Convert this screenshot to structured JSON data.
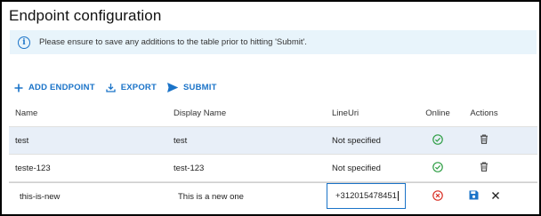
{
  "title": "Endpoint configuration",
  "banner": {
    "icon": "info-icon",
    "message": "Please ensure to save any additions to the table prior to hitting 'Submit'."
  },
  "toolbar": {
    "add": "ADD ENDPOINT",
    "export": "EXPORT",
    "submit": "SUBMIT"
  },
  "columns": {
    "name": "Name",
    "display": "Display Name",
    "lineuri": "LineUri",
    "online": "Online",
    "actions": "Actions"
  },
  "rows": [
    {
      "name": "test",
      "display": "test",
      "lineuri": "Not specified",
      "online": true
    },
    {
      "name": "teste-123",
      "display": "test-123",
      "lineuri": "Not specified",
      "online": true
    }
  ],
  "edit_row": {
    "name": "this-is-new",
    "display": "This is a new one",
    "lineuri": "+312015478451",
    "online": false
  },
  "colors": {
    "accent": "#1a73c8",
    "online": "#2e9e44",
    "offline": "#d93025"
  }
}
